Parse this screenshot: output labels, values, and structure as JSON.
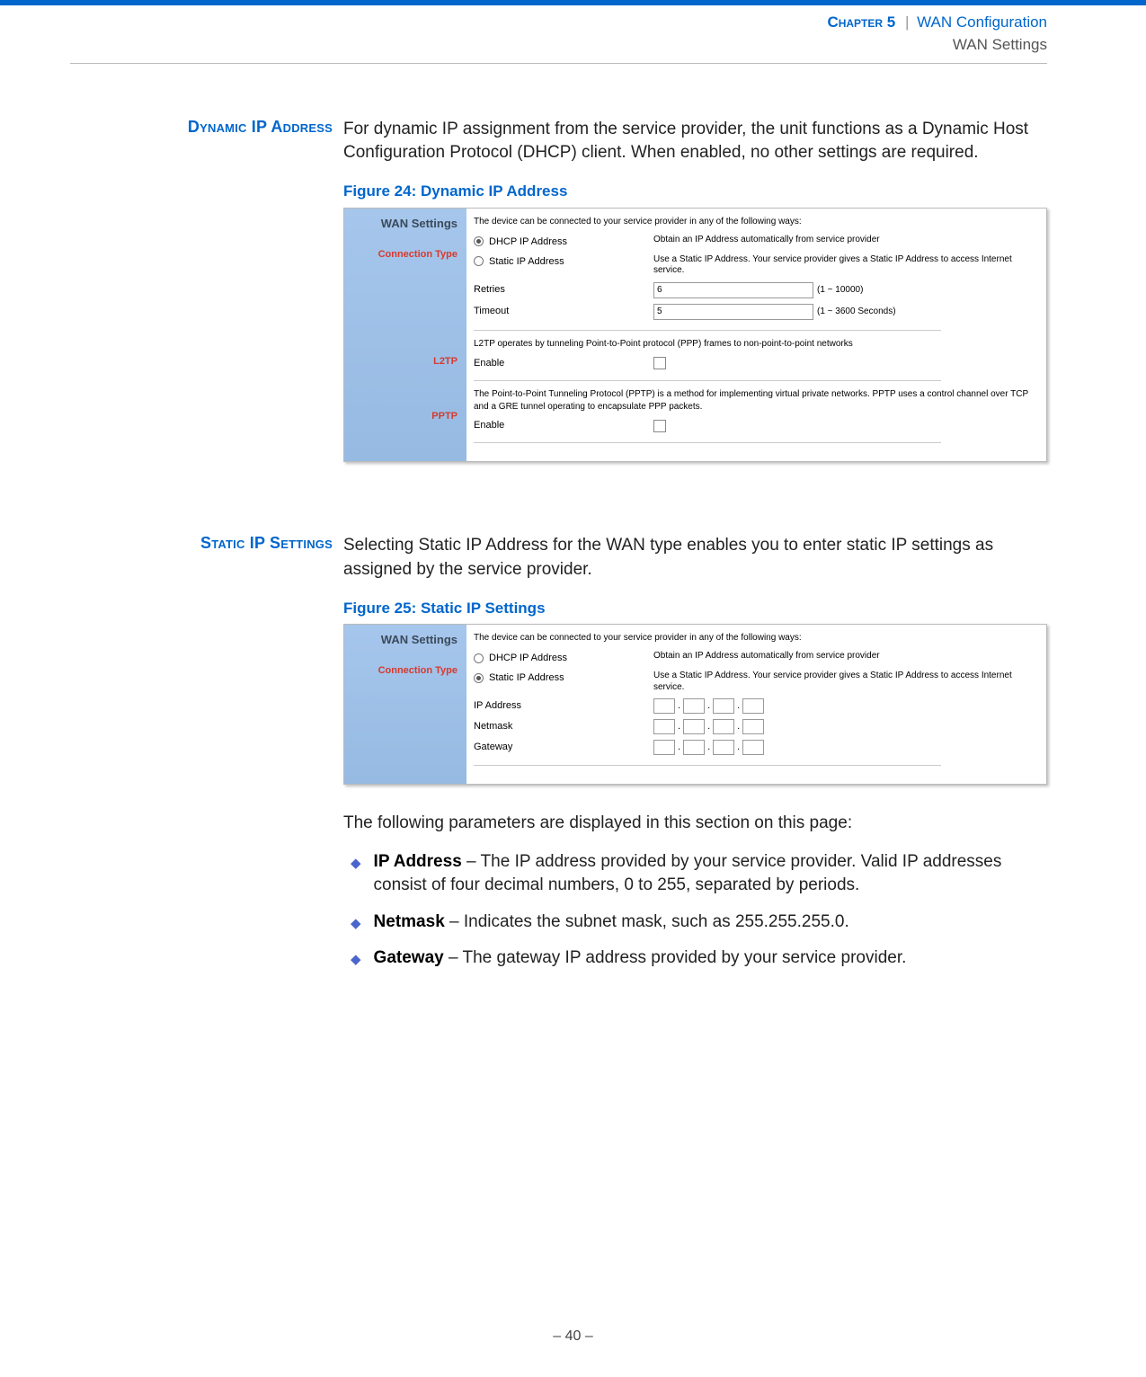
{
  "header": {
    "chapter_label": "Chapter 5",
    "separator": "|",
    "title": "WAN Configuration",
    "subtitle": "WAN Settings"
  },
  "section1": {
    "sidehead": "Dynamic IP Address",
    "body": "For dynamic IP assignment from the service provider, the unit functions as a Dynamic Host Configuration Protocol (DHCP) client. When enabled, no other settings are required.",
    "figure_caption": "Figure 24:  Dynamic IP Address",
    "ss": {
      "left_title": "WAN Settings",
      "left_item_conn": "Connection Type",
      "left_item_l2tp": "L2TP",
      "left_item_pptp": "PPTP",
      "intro": "The device can be connected to your service provider in any of the following ways:",
      "dhcp_label": "DHCP IP Address",
      "dhcp_desc": "Obtain an IP Address automatically from service provider",
      "static_label": "Static IP Address",
      "static_desc": "Use a Static IP Address. Your service provider gives a Static IP Address to access Internet service.",
      "retries_label": "Retries",
      "retries_value": "6",
      "retries_hint": "(1 ~ 10000)",
      "timeout_label": "Timeout",
      "timeout_value": "5",
      "timeout_hint": "(1 ~ 3600 Seconds)",
      "l2tp_text": "L2TP operates by tunneling Point-to-Point protocol (PPP) frames to non-point-to-point networks",
      "enable_label": "Enable",
      "pptp_text": "The Point-to-Point Tunneling Protocol (PPTP) is a method for implementing virtual private networks. PPTP uses a control channel over TCP and a GRE tunnel operating to encapsulate PPP packets."
    }
  },
  "section2": {
    "sidehead": "Static IP Settings",
    "body": "Selecting Static IP Address for the WAN type enables you to enter static IP settings as assigned by the service provider.",
    "figure_caption": "Figure 25:  Static IP Settings",
    "ss": {
      "left_title": "WAN Settings",
      "left_item_conn": "Connection Type",
      "intro": "The device can be connected to your service provider in any of the following ways:",
      "dhcp_label": "DHCP IP Address",
      "dhcp_desc": "Obtain an IP Address automatically from service provider",
      "static_label": "Static IP Address",
      "static_desc": "Use a Static IP Address. Your service provider gives a Static IP Address to access Internet service.",
      "ip_label": "IP Address",
      "netmask_label": "Netmask",
      "gateway_label": "Gateway"
    },
    "param_intro": "The following parameters are displayed in this section on this page:",
    "bullets": [
      {
        "term": "IP Address",
        "text": " – The IP address provided by your service provider. Valid IP addresses consist of four decimal numbers, 0 to 255, separated by periods."
      },
      {
        "term": "Netmask",
        "text": " – Indicates the subnet mask, such as 255.255.255.0."
      },
      {
        "term": "Gateway",
        "text": " – The gateway IP address provided by your service provider."
      }
    ]
  },
  "footer": {
    "page_prefix": "–  ",
    "page_number": "40",
    "page_suffix": "  –"
  }
}
